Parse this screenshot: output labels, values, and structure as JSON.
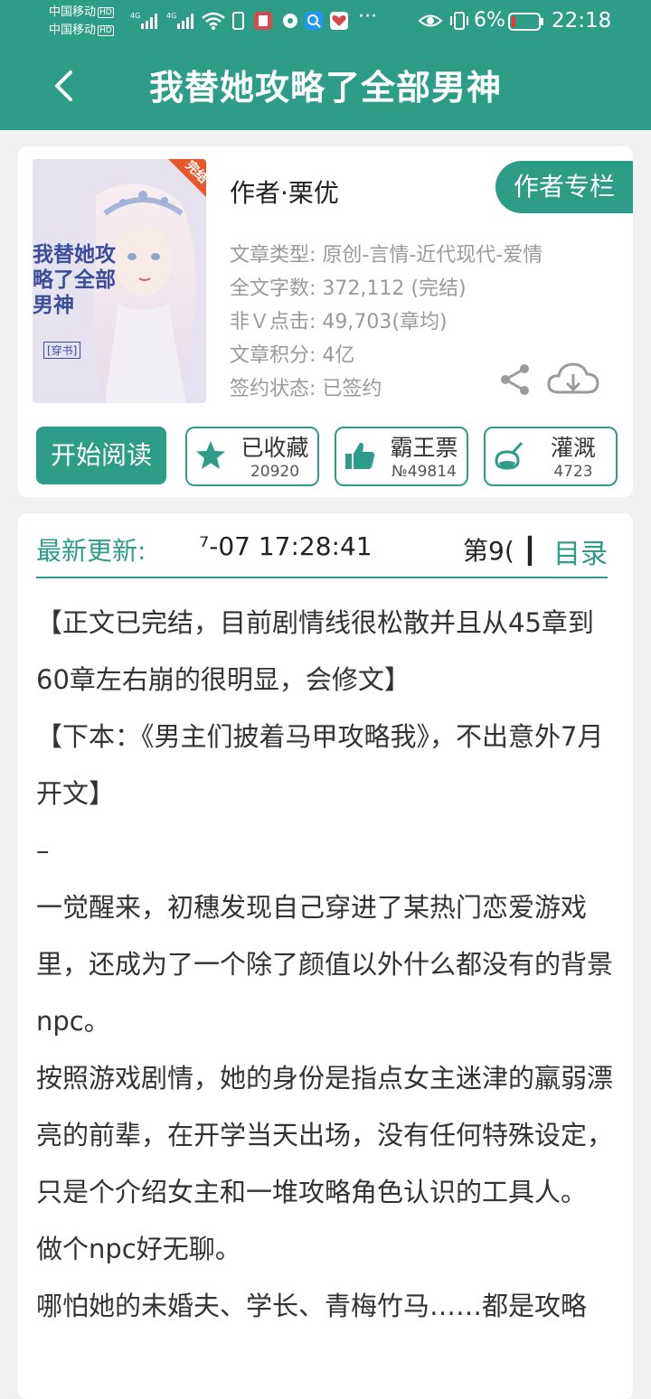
{
  "status_bar": {
    "carrier1": "中国移动",
    "carrier2": "中国移动",
    "hd": "HD",
    "net": "4G",
    "battery_pct": "6%",
    "time": "22:18"
  },
  "header": {
    "title": "我替她攻略了全部男神"
  },
  "book": {
    "cover_title": "我替她攻略了全部男神",
    "cover_badge": "完结",
    "cover_tag": "[穿书]",
    "author_label": "作者·栗优",
    "author_column_button": "作者专栏",
    "meta": [
      {
        "label": "文章类型:",
        "value": "原创-言情-近代现代-爱情"
      },
      {
        "label": "全文字数:",
        "value": "372,112 (完结)"
      },
      {
        "label": "非Ｖ点击:",
        "value": "49,703(章均)"
      },
      {
        "label": "文章积分:",
        "value": "4亿"
      },
      {
        "label": "签约状态:",
        "value": " 已签约"
      }
    ]
  },
  "actions": {
    "read": "开始阅读",
    "favorite": {
      "label": "已收藏",
      "count": "20920"
    },
    "vote": {
      "label": "霸王票",
      "count": "№49814"
    },
    "water": {
      "label": "灌溉",
      "count": "4723"
    }
  },
  "update": {
    "label": "最新更新:",
    "time": "⁷-07 17:28:41",
    "chapter": "第9( ┃",
    "toc": "目录"
  },
  "description": [
    "【正文已完结，目前剧情线很松散并且从45章到60章左右崩的很明显，会修文】",
    "【下本：《男主们披着马甲攻略我》，不出意外7月开文】",
    "–",
    "一觉醒来，初穗发现自己穿进了某热门恋爱游戏里，还成为了一个除了颜值以外什么都没有的背景npc。",
    "按照游戏剧情，她的身份是指点女主迷津的羸弱漂亮的前辈，在开学当天出场，没有任何特殊设定，只是个介绍女主和一堆攻略角色认识的工具人。",
    "做个npc好无聊。",
    "哪怕她的未婚夫、学长、青梅竹马……都是攻略"
  ],
  "colors": {
    "accent": "#2e9d88"
  }
}
